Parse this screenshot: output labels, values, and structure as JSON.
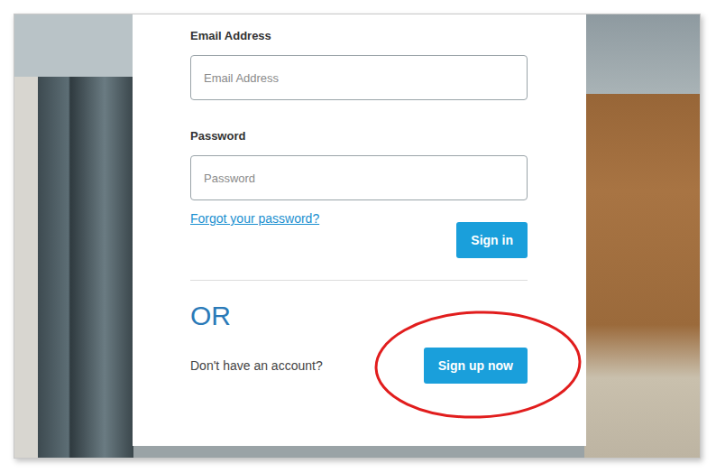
{
  "form": {
    "fields": [
      {
        "label": "Email Address",
        "placeholder": "Email Address",
        "type": "email"
      },
      {
        "label": "Password",
        "placeholder": "Password",
        "type": "password"
      }
    ],
    "forgot_link": "Forgot your password?",
    "sign_in_button": "Sign in",
    "divider_text": "OR",
    "signup_prompt": "Don't have an account?",
    "sign_up_button": {
      "label": "Sign up now",
      "circled": true
    }
  }
}
